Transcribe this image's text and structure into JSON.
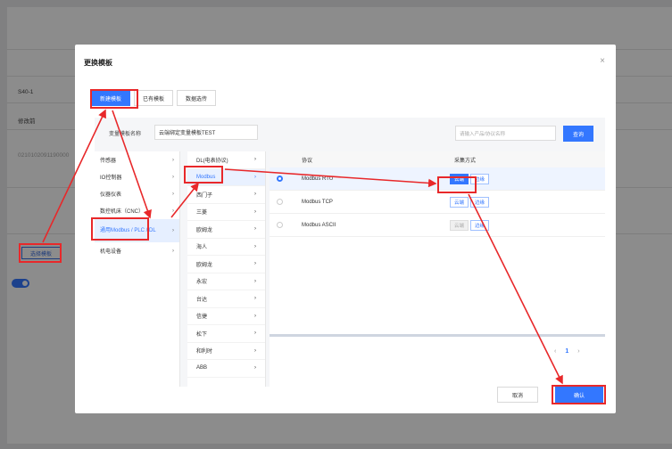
{
  "background": {
    "rows": [
      "S40-1",
      "修改前",
      "0210102091190000"
    ],
    "select_template_button": "选择模板"
  },
  "modal": {
    "title": "更换模板",
    "close_glyph": "×",
    "tabs": [
      "新建模板",
      "已有模板",
      "数据选传"
    ],
    "filter_label": "变量模板名称",
    "filter_value": "云端绑定变量模板TEST",
    "search_placeholder": "请输入产品/协议名称",
    "search_button": "查询",
    "categories": [
      {
        "label": "传感器",
        "arrow": "›"
      },
      {
        "label": "IO控制器",
        "arrow": "›"
      },
      {
        "label": "仪器仪表",
        "arrow": "›"
      },
      {
        "label": "数控机床（CNC）",
        "arrow": "›"
      },
      {
        "label": "通用Modbus / PLC / DL",
        "arrow": "›"
      },
      {
        "label": "机电设备",
        "arrow": "›"
      }
    ],
    "brands": [
      {
        "label": "DL(电表协议)",
        "arrow": "›"
      },
      {
        "label": "Modbus",
        "arrow": "›"
      },
      {
        "label": "西门子",
        "arrow": "›"
      },
      {
        "label": "三菱",
        "arrow": "›"
      },
      {
        "label": "欧姆龙",
        "arrow": "›"
      },
      {
        "label": "海人",
        "arrow": "›"
      },
      {
        "label": "欧姆龙",
        "arrow": "›"
      },
      {
        "label": "永宏",
        "arrow": "›"
      },
      {
        "label": "台达",
        "arrow": "›"
      },
      {
        "label": "信捷",
        "arrow": "›"
      },
      {
        "label": "松下",
        "arrow": "›"
      },
      {
        "label": "和利时",
        "arrow": "›"
      },
      {
        "label": "ABB",
        "arrow": "›"
      }
    ],
    "protocol_header": "协议",
    "method_header": "采集方式",
    "protocols": [
      {
        "name": "Modbus RTU",
        "cloud": "云端",
        "edge": "边缘"
      },
      {
        "name": "Modbus TCP",
        "cloud": "云端",
        "edge": "边缘"
      },
      {
        "name": "Modbus ASCII",
        "cloud": "云端",
        "edge": "边缘"
      }
    ],
    "pager": {
      "prev": "‹",
      "page": "1",
      "next": "›"
    },
    "cancel_button": "取消",
    "ok_button": "确认"
  },
  "colors": {
    "accent": "#3377ff",
    "annotation": "#e8282a"
  }
}
